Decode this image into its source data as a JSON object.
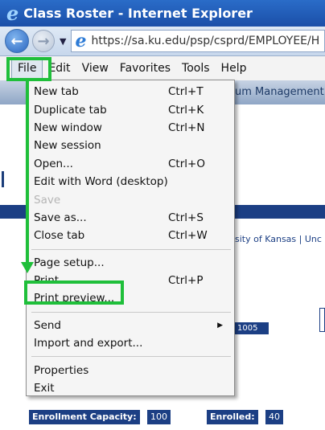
{
  "window": {
    "title": "Class Roster - Internet Explorer",
    "url": "https://sa.ku.edu/psp/csprd/EMPLOYEE/H"
  },
  "menubar": [
    "File",
    "Edit",
    "View",
    "Favorites",
    "Tools",
    "Help"
  ],
  "page": {
    "header_text": "um Management",
    "university_line": "sity of Kansas | Unc",
    "class_number": "1005",
    "enrollment_capacity_label": "Enrollment Capacity:",
    "enrollment_capacity_value": "100",
    "enrolled_label": "Enrolled:",
    "enrolled_value": "40"
  },
  "file_menu": {
    "groups": [
      [
        {
          "label": "New tab",
          "shortcut": "Ctrl+T"
        },
        {
          "label": "Duplicate tab",
          "shortcut": "Ctrl+K"
        },
        {
          "label": "New window",
          "shortcut": "Ctrl+N"
        },
        {
          "label": "New session",
          "shortcut": ""
        },
        {
          "label": "Open...",
          "shortcut": "Ctrl+O"
        },
        {
          "label": "Edit with Word (desktop)",
          "shortcut": ""
        },
        {
          "label": "Save",
          "shortcut": "",
          "disabled": true
        },
        {
          "label": "Save as...",
          "shortcut": "Ctrl+S"
        },
        {
          "label": "Close tab",
          "shortcut": "Ctrl+W"
        }
      ],
      [
        {
          "label": "Page setup...",
          "shortcut": ""
        },
        {
          "label": "Print...",
          "shortcut": "Ctrl+P"
        },
        {
          "label": "Print preview...",
          "shortcut": ""
        }
      ],
      [
        {
          "label": "Send",
          "shortcut": "",
          "submenu": true
        },
        {
          "label": "Import and export...",
          "shortcut": ""
        }
      ],
      [
        {
          "label": "Properties",
          "shortcut": ""
        },
        {
          "label": "Exit",
          "shortcut": ""
        }
      ]
    ]
  },
  "colors": {
    "highlight": "#1fbf3a",
    "titlebar": "#1b4fa8",
    "page_navy": "#1c3f84"
  }
}
